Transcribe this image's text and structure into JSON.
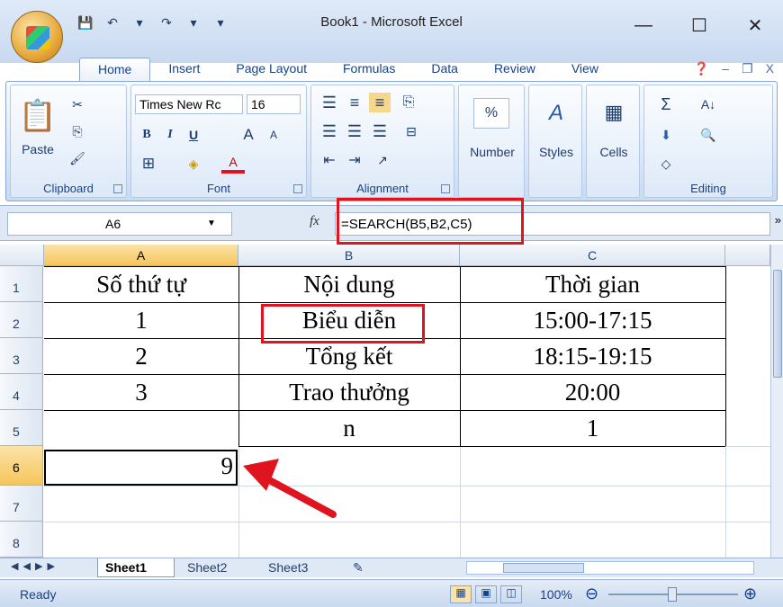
{
  "window": {
    "title": "Book1 - Microsoft Excel",
    "controls": [
      "—",
      "☐",
      "✕"
    ]
  },
  "qat": {
    "save": "💾",
    "undo": "↶",
    "undo_drop": "▾",
    "redo": "↷",
    "redo_drop": "▾",
    "customize": "▾"
  },
  "tabs": [
    "Home",
    "Insert",
    "Page Layout",
    "Formulas",
    "Data",
    "Review",
    "View"
  ],
  "help": {
    "help": "❓",
    "min": "–",
    "restore": "❐",
    "close": "X"
  },
  "ribbon": {
    "clipboard": {
      "label": "Clipboard",
      "paste": "Paste",
      "cut": "✂",
      "copy": "⎘",
      "painter": "🖌"
    },
    "font": {
      "label": "Font",
      "name": "Times New Rc",
      "size": "16",
      "bold": "B",
      "italic": "I",
      "underline": "U",
      "grow": "A",
      "shrink": "A",
      "border": "⊞",
      "fill": "◈",
      "color": "A"
    },
    "alignment": {
      "label": "Alignment"
    },
    "number": {
      "label": "Number",
      "percent": "%"
    },
    "styles": {
      "label": "Styles",
      "icon": "A"
    },
    "cells": {
      "label": "Cells"
    },
    "editing": {
      "label": "Editing",
      "sum": "Σ",
      "sort": "A↓",
      "find": "🔍",
      "fill": "⬇",
      "clear": "◇"
    }
  },
  "formula_bar": {
    "name_box": "A6",
    "fx": "fx",
    "formula": "=SEARCH(B5,B2,C5)"
  },
  "grid": {
    "columns": [
      "A",
      "B",
      "C"
    ],
    "rows": [
      "1",
      "2",
      "3",
      "4",
      "5",
      "6",
      "7",
      "8"
    ],
    "cells": [
      [
        "Số thứ tự",
        "Nội dung",
        "Thời gian"
      ],
      [
        "1",
        "Biểu diễn",
        "15:00-17:15"
      ],
      [
        "2",
        "Tổng kết",
        "18:15-19:15"
      ],
      [
        "3",
        "Trao thưởng",
        "20:00"
      ],
      [
        "",
        "n",
        "1"
      ],
      [
        "9",
        "",
        ""
      ]
    ]
  },
  "sheets": {
    "nav": "◀ ◀ ▶ ▶",
    "tabs": [
      "Sheet1",
      "Sheet2",
      "Sheet3"
    ],
    "active": "Sheet1"
  },
  "status": {
    "ready": "Ready",
    "zoom": "100%",
    "zoom_out": "⊖",
    "zoom_in": "⊕"
  },
  "annotation_colors": {
    "red": "#e0141e",
    "select_header": "#f6c55a"
  }
}
